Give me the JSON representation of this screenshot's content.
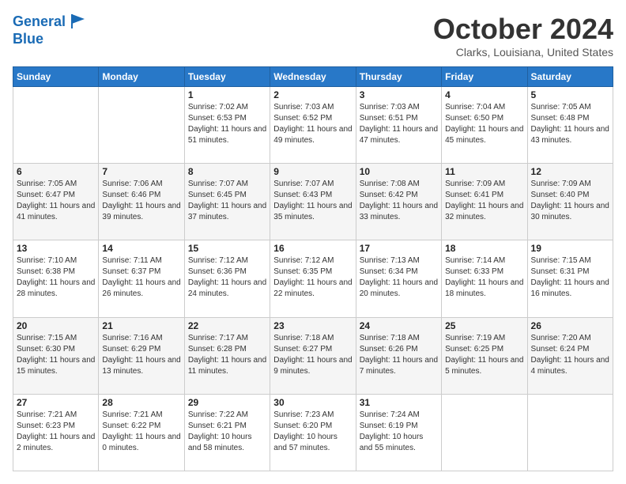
{
  "header": {
    "logo_line1": "General",
    "logo_line2": "Blue",
    "month_title": "October 2024",
    "location": "Clarks, Louisiana, United States"
  },
  "days_of_week": [
    "Sunday",
    "Monday",
    "Tuesday",
    "Wednesday",
    "Thursday",
    "Friday",
    "Saturday"
  ],
  "weeks": [
    [
      {
        "day": "",
        "info": ""
      },
      {
        "day": "",
        "info": ""
      },
      {
        "day": "1",
        "info": "Sunrise: 7:02 AM\nSunset: 6:53 PM\nDaylight: 11 hours and 51 minutes."
      },
      {
        "day": "2",
        "info": "Sunrise: 7:03 AM\nSunset: 6:52 PM\nDaylight: 11 hours and 49 minutes."
      },
      {
        "day": "3",
        "info": "Sunrise: 7:03 AM\nSunset: 6:51 PM\nDaylight: 11 hours and 47 minutes."
      },
      {
        "day": "4",
        "info": "Sunrise: 7:04 AM\nSunset: 6:50 PM\nDaylight: 11 hours and 45 minutes."
      },
      {
        "day": "5",
        "info": "Sunrise: 7:05 AM\nSunset: 6:48 PM\nDaylight: 11 hours and 43 minutes."
      }
    ],
    [
      {
        "day": "6",
        "info": "Sunrise: 7:05 AM\nSunset: 6:47 PM\nDaylight: 11 hours and 41 minutes."
      },
      {
        "day": "7",
        "info": "Sunrise: 7:06 AM\nSunset: 6:46 PM\nDaylight: 11 hours and 39 minutes."
      },
      {
        "day": "8",
        "info": "Sunrise: 7:07 AM\nSunset: 6:45 PM\nDaylight: 11 hours and 37 minutes."
      },
      {
        "day": "9",
        "info": "Sunrise: 7:07 AM\nSunset: 6:43 PM\nDaylight: 11 hours and 35 minutes."
      },
      {
        "day": "10",
        "info": "Sunrise: 7:08 AM\nSunset: 6:42 PM\nDaylight: 11 hours and 33 minutes."
      },
      {
        "day": "11",
        "info": "Sunrise: 7:09 AM\nSunset: 6:41 PM\nDaylight: 11 hours and 32 minutes."
      },
      {
        "day": "12",
        "info": "Sunrise: 7:09 AM\nSunset: 6:40 PM\nDaylight: 11 hours and 30 minutes."
      }
    ],
    [
      {
        "day": "13",
        "info": "Sunrise: 7:10 AM\nSunset: 6:38 PM\nDaylight: 11 hours and 28 minutes."
      },
      {
        "day": "14",
        "info": "Sunrise: 7:11 AM\nSunset: 6:37 PM\nDaylight: 11 hours and 26 minutes."
      },
      {
        "day": "15",
        "info": "Sunrise: 7:12 AM\nSunset: 6:36 PM\nDaylight: 11 hours and 24 minutes."
      },
      {
        "day": "16",
        "info": "Sunrise: 7:12 AM\nSunset: 6:35 PM\nDaylight: 11 hours and 22 minutes."
      },
      {
        "day": "17",
        "info": "Sunrise: 7:13 AM\nSunset: 6:34 PM\nDaylight: 11 hours and 20 minutes."
      },
      {
        "day": "18",
        "info": "Sunrise: 7:14 AM\nSunset: 6:33 PM\nDaylight: 11 hours and 18 minutes."
      },
      {
        "day": "19",
        "info": "Sunrise: 7:15 AM\nSunset: 6:31 PM\nDaylight: 11 hours and 16 minutes."
      }
    ],
    [
      {
        "day": "20",
        "info": "Sunrise: 7:15 AM\nSunset: 6:30 PM\nDaylight: 11 hours and 15 minutes."
      },
      {
        "day": "21",
        "info": "Sunrise: 7:16 AM\nSunset: 6:29 PM\nDaylight: 11 hours and 13 minutes."
      },
      {
        "day": "22",
        "info": "Sunrise: 7:17 AM\nSunset: 6:28 PM\nDaylight: 11 hours and 11 minutes."
      },
      {
        "day": "23",
        "info": "Sunrise: 7:18 AM\nSunset: 6:27 PM\nDaylight: 11 hours and 9 minutes."
      },
      {
        "day": "24",
        "info": "Sunrise: 7:18 AM\nSunset: 6:26 PM\nDaylight: 11 hours and 7 minutes."
      },
      {
        "day": "25",
        "info": "Sunrise: 7:19 AM\nSunset: 6:25 PM\nDaylight: 11 hours and 5 minutes."
      },
      {
        "day": "26",
        "info": "Sunrise: 7:20 AM\nSunset: 6:24 PM\nDaylight: 11 hours and 4 minutes."
      }
    ],
    [
      {
        "day": "27",
        "info": "Sunrise: 7:21 AM\nSunset: 6:23 PM\nDaylight: 11 hours and 2 minutes."
      },
      {
        "day": "28",
        "info": "Sunrise: 7:21 AM\nSunset: 6:22 PM\nDaylight: 11 hours and 0 minutes."
      },
      {
        "day": "29",
        "info": "Sunrise: 7:22 AM\nSunset: 6:21 PM\nDaylight: 10 hours and 58 minutes."
      },
      {
        "day": "30",
        "info": "Sunrise: 7:23 AM\nSunset: 6:20 PM\nDaylight: 10 hours and 57 minutes."
      },
      {
        "day": "31",
        "info": "Sunrise: 7:24 AM\nSunset: 6:19 PM\nDaylight: 10 hours and 55 minutes."
      },
      {
        "day": "",
        "info": ""
      },
      {
        "day": "",
        "info": ""
      }
    ]
  ]
}
